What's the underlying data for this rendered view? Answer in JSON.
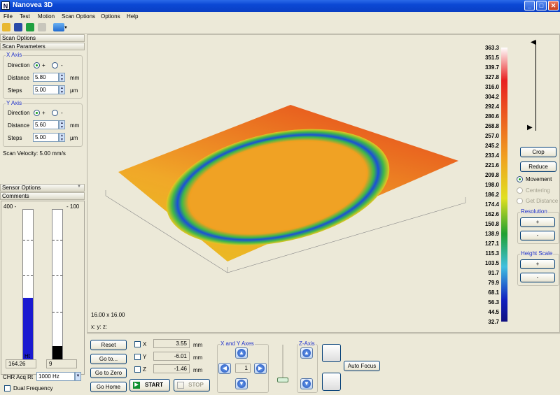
{
  "window": {
    "title": "Nanovea 3D",
    "app_icon": "N"
  },
  "menu": [
    "File",
    "Test",
    "Motion",
    "Scan Options",
    "Options",
    "Help"
  ],
  "left": {
    "scan_options_label": "Scan Options",
    "scan_parameters_label": "Scan Parameters",
    "x_axis": {
      "label": "X Axis",
      "direction_label": "Direction",
      "plus": "+",
      "minus": "-",
      "distance_label": "Distance",
      "distance": "5.80",
      "distance_unit": "mm",
      "steps_label": "Steps",
      "steps": "5.00",
      "steps_unit": "µm"
    },
    "y_axis": {
      "label": "Y Axis",
      "direction_label": "Direction",
      "plus": "+",
      "minus": "-",
      "distance_label": "Distance",
      "distance": "5.60",
      "distance_unit": "mm",
      "steps_label": "Steps",
      "steps": "5.00",
      "steps_unit": "µm"
    },
    "scan_velocity": "Scan Velocity: 5.00 mm/s",
    "sensor_options_label": "Sensor Options",
    "comments_label": "Comments",
    "gauge_left_max": "400 -",
    "gauge_right_max": "- 100",
    "ht_label": "Ht",
    "int_label": "Int",
    "ht_value": "164.26",
    "int_value": "9",
    "ht_level": 0.41,
    "int_level": 0.09,
    "chr_label": "CHR Acq Rt",
    "chr_value": "1000 Hz",
    "dual_frequency": "Dual Frequency"
  },
  "view": {
    "size_label": "16.00 x 16.00",
    "coords_label": "x: y: z:"
  },
  "scale": {
    "ticks": [
      "363.3",
      "351.5",
      "339.7",
      "327.8",
      "316.0",
      "304.2",
      "292.4",
      "280.6",
      "268.8",
      "257.0",
      "245.2",
      "233.4",
      "221.6",
      "209.8",
      "198.0",
      "186.2",
      "174.4",
      "162.6",
      "150.8",
      "138.9",
      "127.1",
      "115.3",
      "103.5",
      "91.7",
      "79.9",
      "68.1",
      "56.3",
      "44.5",
      "32.7"
    ]
  },
  "right": {
    "crop": "Crop",
    "reduce": "Reduce",
    "movement": "Movement",
    "centering": "Centering",
    "get_distance": "Get Distance",
    "resolution_label": "Resolution",
    "height_scale_label": "Height Scale",
    "plus": "+",
    "minus": "-"
  },
  "bottom": {
    "reset": "Reset",
    "goto": "Go to...",
    "goto_zero": "Go to Zero",
    "go_home": "Go Home",
    "start": "START",
    "stop": "STOP",
    "x_label": "X",
    "x_value": "3.55",
    "y_label": "Y",
    "y_value": "-6.01",
    "z_label": "Z",
    "z_value": "-1.46",
    "unit": "mm",
    "xy_axes_label": "X and Y Axes",
    "step_value": "1",
    "z_axis_label": "Z-Axis",
    "auto_focus": "Auto Focus"
  },
  "colors": {
    "titlebar": "#0b48d4",
    "face": "#ece9d8",
    "gauge_ht": "#1a1ad0",
    "gauge_int": "#000000"
  }
}
